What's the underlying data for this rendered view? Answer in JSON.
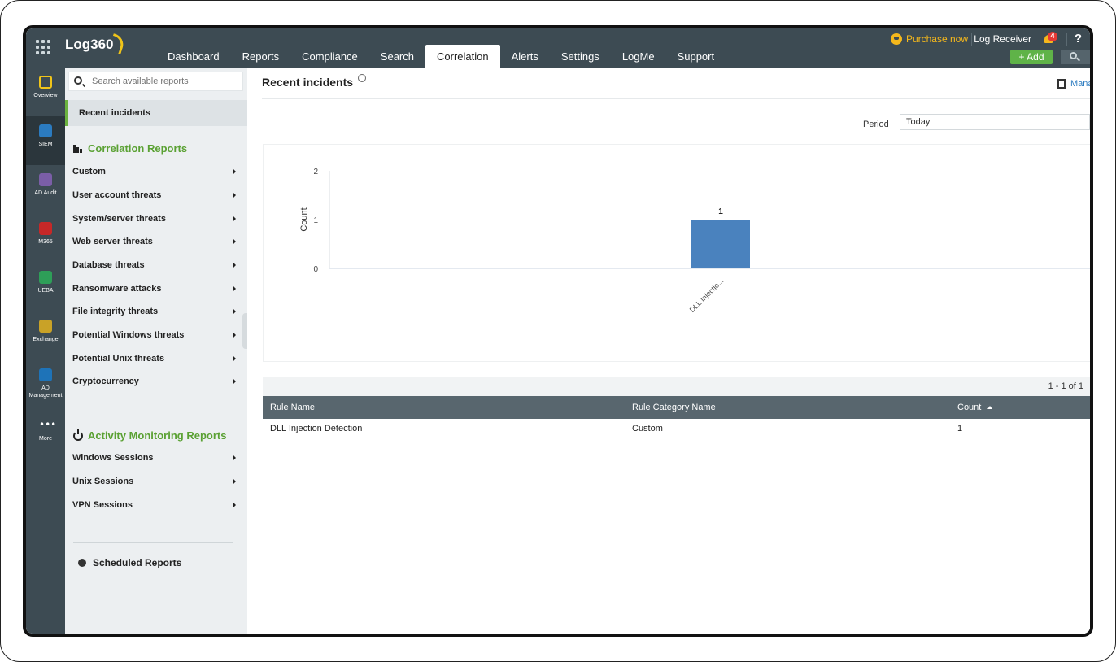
{
  "app": {
    "logo_text": "Log360"
  },
  "nav": {
    "tabs": [
      {
        "label": "Dashboard"
      },
      {
        "label": "Reports"
      },
      {
        "label": "Compliance"
      },
      {
        "label": "Search"
      },
      {
        "label": "Correlation",
        "active": true
      },
      {
        "label": "Alerts"
      },
      {
        "label": "Settings"
      },
      {
        "label": "LogMe"
      },
      {
        "label": "Support"
      }
    ]
  },
  "top_right": {
    "purchase_label": "Purchase now",
    "log_receiver_label": "Log Receiver",
    "notification_count": "4",
    "help_label": "?",
    "add_label": "+ Add"
  },
  "rail": {
    "items": [
      {
        "label": "Overview",
        "icon": "overview-icon",
        "color": "#f0c419"
      },
      {
        "label": "SIEM",
        "icon": "shield-icon",
        "color": "#2b7bc0",
        "active": true
      },
      {
        "label": "AD Audit",
        "icon": "audit-search-icon",
        "color": "#7b5ea7"
      },
      {
        "label": "M365",
        "icon": "office-icon",
        "color": "#c62828"
      },
      {
        "label": "UEBA",
        "icon": "eye-icon",
        "color": "#2e9e58"
      },
      {
        "label": "Exchange",
        "icon": "mail-icon",
        "color": "#c9a227"
      },
      {
        "label": "AD Management",
        "icon": "directory-icon",
        "color": "#1e73b8"
      },
      {
        "label": "More",
        "icon": "more-dots-icon",
        "color": "#ffffff"
      }
    ]
  },
  "sidebar": {
    "search_placeholder": "Search available reports",
    "recent_label": "Recent incidents",
    "correlation_title": "Correlation Reports",
    "correlation_items": [
      {
        "label": "Custom"
      },
      {
        "label": "User account threats"
      },
      {
        "label": "System/server threats"
      },
      {
        "label": "Web server threats"
      },
      {
        "label": "Database threats"
      },
      {
        "label": "Ransomware attacks"
      },
      {
        "label": "File integrity threats"
      },
      {
        "label": "Potential Windows threats"
      },
      {
        "label": "Potential Unix threats"
      },
      {
        "label": "Cryptocurrency"
      }
    ],
    "activity_title": "Activity Monitoring Reports",
    "activity_items": [
      {
        "label": "Windows Sessions"
      },
      {
        "label": "Unix Sessions"
      },
      {
        "label": "VPN Sessions"
      }
    ],
    "scheduled_label": "Scheduled Reports"
  },
  "main": {
    "title": "Recent incidents",
    "manage_label": "Manage",
    "period_label": "Period",
    "period_value": "Today",
    "pager": "1 - 1 of 1",
    "table": {
      "headers": [
        "Rule Name",
        "Rule Category Name",
        "Count"
      ],
      "rows": [
        [
          "DLL Injection Detection",
          "Custom",
          "1"
        ]
      ]
    }
  },
  "chart_data": {
    "type": "bar",
    "categories": [
      "DLL Injectio..."
    ],
    "values": [
      1
    ],
    "data_labels": [
      "1"
    ],
    "ylabel": "Count",
    "yticks": [
      0,
      1,
      2
    ],
    "ylim": [
      0,
      2
    ],
    "bar_color": "#4a82be",
    "grid": false
  }
}
